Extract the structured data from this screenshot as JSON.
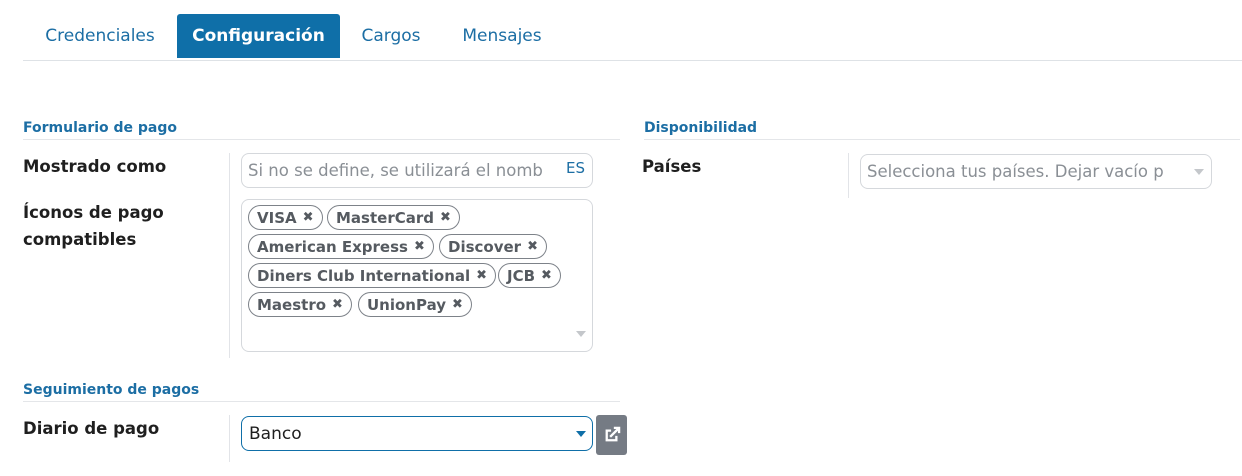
{
  "tabs": [
    {
      "label": "Credenciales"
    },
    {
      "label": "Configuración",
      "active": true
    },
    {
      "label": "Cargos"
    },
    {
      "label": "Mensajes"
    }
  ],
  "payment_form": {
    "title": "Formulario de pago",
    "shown_as_label": "Mostrado como",
    "shown_as_placeholder": "Si no se define, se utilizará el nomb",
    "lang_badge": "ES",
    "icons_label": "Íconos de pago compatibles",
    "icons": [
      "VISA",
      "MasterCard",
      "American Express",
      "Discover",
      "Diners Club International",
      "JCB",
      "Maestro",
      "UnionPay"
    ]
  },
  "availability": {
    "title": "Disponibilidad",
    "countries_label": "Países",
    "countries_placeholder": "Selecciona tus países. Dejar vacío p"
  },
  "tracking": {
    "title": "Seguimiento de pagos",
    "journal_label": "Diario de pago",
    "journal_value": "Banco"
  },
  "colors": {
    "accent": "#0f6fa8",
    "link": "#1c6ea4"
  },
  "icons": {
    "tag_remove": "times-icon",
    "dropdown": "caret-down-icon",
    "external": "external-link-icon"
  }
}
